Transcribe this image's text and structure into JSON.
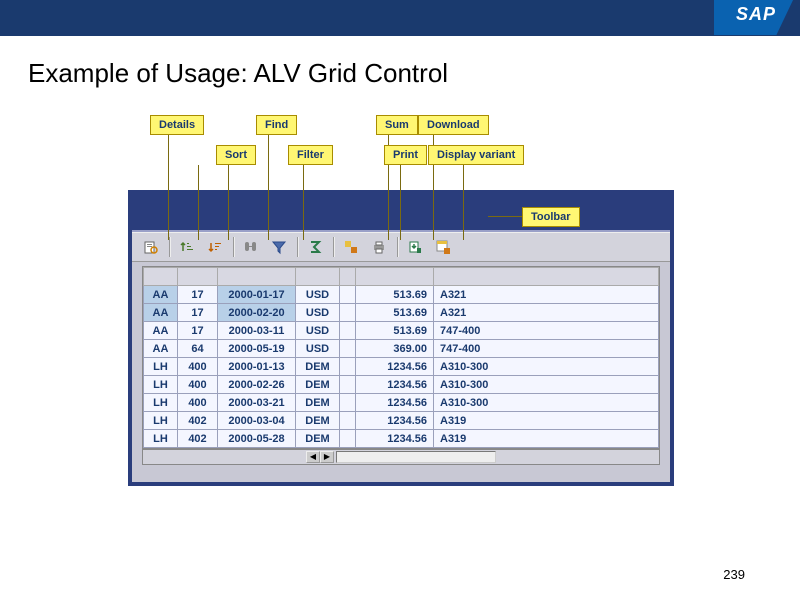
{
  "brand": "SAP",
  "title": "Example of Usage: ALV Grid Control",
  "page_number": "239",
  "callouts": {
    "details": "Details",
    "sort": "Sort",
    "find": "Find",
    "filter": "Filter",
    "sum": "Sum",
    "print": "Print",
    "download": "Download",
    "display_variant": "Display variant",
    "toolbar": "Toolbar"
  },
  "grid": {
    "columns": [
      "",
      "",
      "",
      "",
      "",
      "",
      ""
    ],
    "rows": [
      {
        "carr": "AA",
        "conn": "17",
        "date": "2000-01-17",
        "curr": "USD",
        "amt": "513.69",
        "plane": "A321",
        "sel": true
      },
      {
        "carr": "AA",
        "conn": "17",
        "date": "2000-02-20",
        "curr": "USD",
        "amt": "513.69",
        "plane": "A321",
        "sel": true
      },
      {
        "carr": "AA",
        "conn": "17",
        "date": "2000-03-11",
        "curr": "USD",
        "amt": "513.69",
        "plane": "747-400",
        "sel": false
      },
      {
        "carr": "AA",
        "conn": "64",
        "date": "2000-05-19",
        "curr": "USD",
        "amt": "369.00",
        "plane": "747-400",
        "sel": false
      },
      {
        "carr": "LH",
        "conn": "400",
        "date": "2000-01-13",
        "curr": "DEM",
        "amt": "1234.56",
        "plane": "A310-300",
        "sel": false
      },
      {
        "carr": "LH",
        "conn": "400",
        "date": "2000-02-26",
        "curr": "DEM",
        "amt": "1234.56",
        "plane": "A310-300",
        "sel": false
      },
      {
        "carr": "LH",
        "conn": "400",
        "date": "2000-03-21",
        "curr": "DEM",
        "amt": "1234.56",
        "plane": "A310-300",
        "sel": false
      },
      {
        "carr": "LH",
        "conn": "402",
        "date": "2000-03-04",
        "curr": "DEM",
        "amt": "1234.56",
        "plane": "A319",
        "sel": false
      },
      {
        "carr": "LH",
        "conn": "402",
        "date": "2000-05-28",
        "curr": "DEM",
        "amt": "1234.56",
        "plane": "A319",
        "sel": false
      }
    ]
  }
}
